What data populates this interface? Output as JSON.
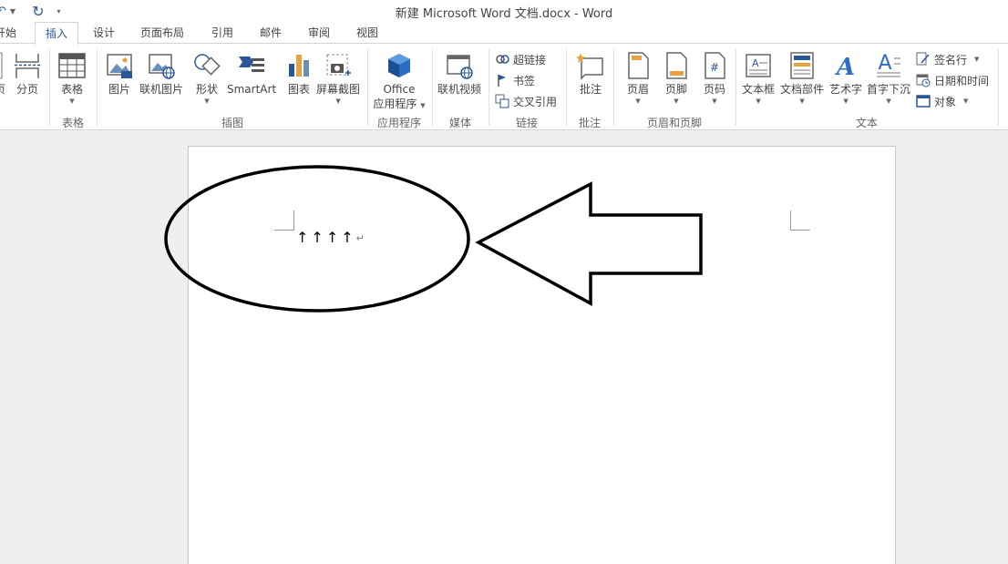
{
  "window": {
    "title": "新建 Microsoft Word 文档.docx - Word"
  },
  "quick_access": {
    "undo_icon": "undo-icon",
    "redo_icon": "redo-icon",
    "customize_icon": "qat-customize-icon"
  },
  "tabs": [
    {
      "label": "开始"
    },
    {
      "label": "插入"
    },
    {
      "label": "设计"
    },
    {
      "label": "页面布局"
    },
    {
      "label": "引用"
    },
    {
      "label": "邮件"
    },
    {
      "label": "审阅"
    },
    {
      "label": "视图"
    }
  ],
  "active_tab": "插入",
  "ribbon": {
    "pages": {
      "page_break": "分页",
      "label_partial": "页"
    },
    "tables": {
      "table": "表格",
      "group": "表格"
    },
    "illustrations": {
      "picture": "图片",
      "online_picture": "联机图片",
      "shapes": "形状",
      "smartart": "SmartArt",
      "chart": "图表",
      "screenshot": "屏幕截图",
      "group": "插图"
    },
    "apps": {
      "line1": "Office",
      "line2": "应用程序",
      "group": "应用程序"
    },
    "media": {
      "online_video": "联机视频",
      "group": "媒体"
    },
    "links": {
      "hyperlink": "超链接",
      "bookmark": "书签",
      "cross_reference": "交叉引用",
      "group": "链接"
    },
    "comments": {
      "comment": "批注",
      "group": "批注"
    },
    "header_footer": {
      "header": "页眉",
      "footer": "页脚",
      "page_number": "页码",
      "group": "页眉和页脚"
    },
    "text": {
      "text_box": "文本框",
      "quick_parts": "文档部件",
      "wordart": "艺术字",
      "drop_cap": "首字下沉",
      "signature_line": "签名行",
      "date_time": "日期和时间",
      "object": "对象",
      "group": "文本"
    }
  },
  "document": {
    "line_text": "↑↑↑↑",
    "paragraph_mark": "↵"
  },
  "colors": {
    "accent": "#2b579a",
    "annotation": "#000000"
  }
}
